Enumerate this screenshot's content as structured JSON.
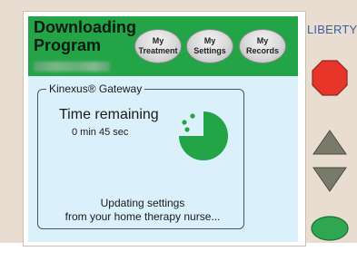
{
  "program": {
    "title_line1": "Downloading",
    "title_line2": "Program"
  },
  "menu": [
    {
      "line1": "My",
      "line2": "Treatment"
    },
    {
      "line1": "My",
      "line2": "Settings"
    },
    {
      "line1": "My",
      "line2": "Records"
    }
  ],
  "gateway": {
    "label": "Kinexus® Gateway",
    "time_label": "Time remaining",
    "time_value": "0 min 45 sec",
    "progress_fraction": 0.75,
    "status_line1": "Updating settings",
    "status_line2": "from your home therapy nurse..."
  },
  "device": {
    "brand": "LIBERTY",
    "brand_mark": "®"
  },
  "colors": {
    "header_green": "#22a447",
    "screen_bg": "#daf0fb",
    "stop_red": "#e8352a",
    "arrow_gray": "#7a7a6a",
    "ok_green": "#2fa651"
  },
  "icons": [
    "progress-pie-icon",
    "stop-button-icon",
    "up-arrow-icon",
    "down-arrow-icon",
    "ok-button-icon"
  ]
}
